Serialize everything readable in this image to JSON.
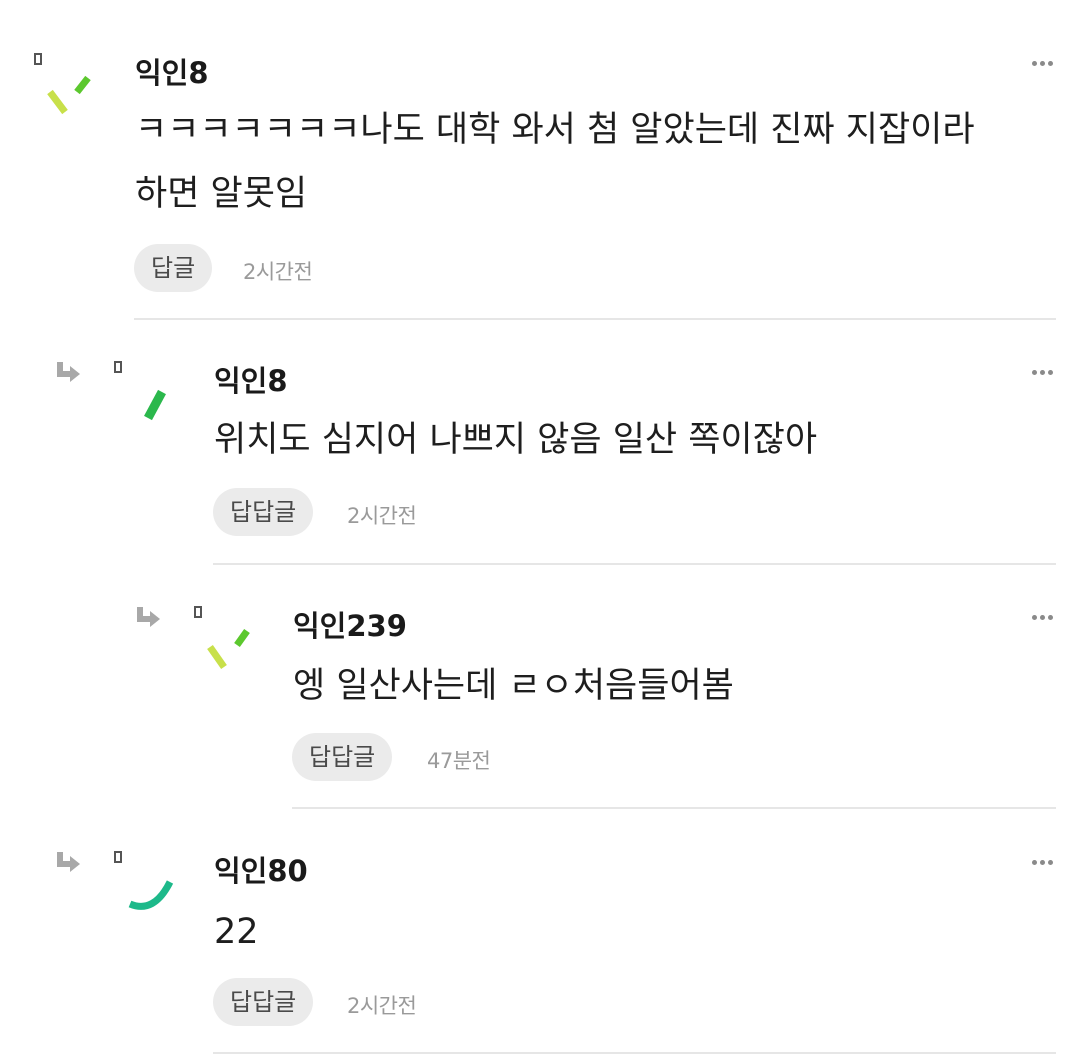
{
  "comments": [
    {
      "author": "익인8",
      "lines": [
        "ㅋㅋㅋㅋㅋㅋㅋ나도 대학 와서 첨 알았는데 진짜 지잡이라",
        "하면 알못임"
      ],
      "reply_label": "답글",
      "time": "2시간전",
      "avatar_colors": [
        "#c8e04a",
        "#5cc82e"
      ]
    },
    {
      "author": "익인8",
      "lines": [
        "위치도 심지어 나쁘지 않음 일산 쪽이잖아"
      ],
      "reply_label": "답답글",
      "time": "2시간전",
      "avatar_colors": [
        "#2bb84c"
      ]
    },
    {
      "author": "익인239",
      "lines": [
        "엥 일산사는데 ㄹㅇ처음들어봄"
      ],
      "reply_label": "답답글",
      "time": "47분전",
      "avatar_colors": [
        "#c8e04a",
        "#5cc82e"
      ]
    },
    {
      "author": "익인80",
      "lines": [
        "22"
      ],
      "reply_label": "답답글",
      "time": "2시간전",
      "avatar_colors": [
        "#1db98a"
      ]
    }
  ],
  "icons": {
    "reply_arrow": "reply-arrow-icon",
    "more": "more-options-icon",
    "avatar_marker": "avatar-marker-icon"
  }
}
